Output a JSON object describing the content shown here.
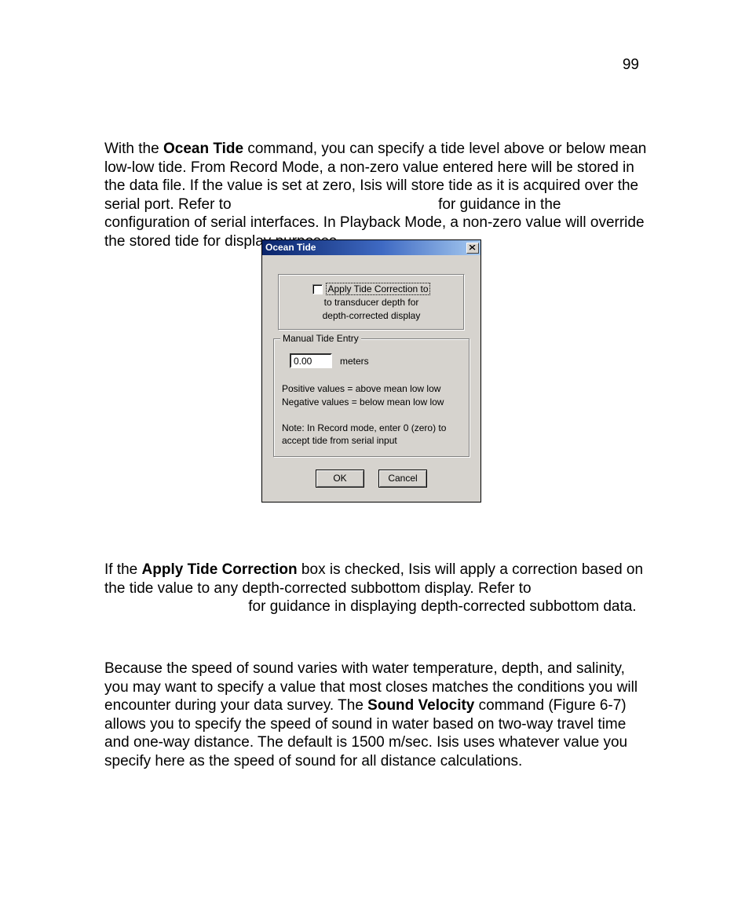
{
  "page_number": "99",
  "para1": {
    "t1": "With the ",
    "b1": "Ocean Tide",
    "t2": " command, you can specify a tide level above or below mean low-low tide. From Record Mode, a non-zero value entered here will be stored in the data file. If the value is set at zero, Isis will store tide as it is acquired over the serial port. Refer to ",
    "t3": " for guidance in the configuration of serial interfaces. In Playback Mode, a non-zero value will override the stored tide for display purposes."
  },
  "dialog": {
    "title": "Ocean Tide",
    "checkbox_label": "Apply Tide Correction to",
    "checkbox_sub1": "to transducer depth for",
    "checkbox_sub2": "depth-corrected  display",
    "group_legend": "Manual Tide Entry",
    "entry_value": "0.00",
    "entry_unit": "meters",
    "explain_pos": "Positive values = above mean low low",
    "explain_neg": "Negative values = below mean low low",
    "note": "Note: In Record mode, enter 0 (zero) to accept tide from serial input",
    "ok_label": "OK",
    "cancel_label": "Cancel"
  },
  "para2": {
    "t1": "If the ",
    "b1": "Apply Tide Correction",
    "t2": " box is checked, Isis will apply a correction based on the tide value to any depth-corrected subbottom display. Refer to ",
    "t3": " for guidance in displaying depth-corrected subbottom data."
  },
  "para3": {
    "t1": "Because the speed of sound varies with water temperature, depth, and salinity, you may want to specify a value that most closes matches the conditions you will encounter during your data survey. The ",
    "b1": "Sound Velocity",
    "t2": " command (Figure 6-7) allows you to specify the speed of sound in water based on two-way travel time and one-way distance. The default is 1500 m/sec. Isis uses whatever value you specify here as the speed of sound for all distance calculations."
  }
}
